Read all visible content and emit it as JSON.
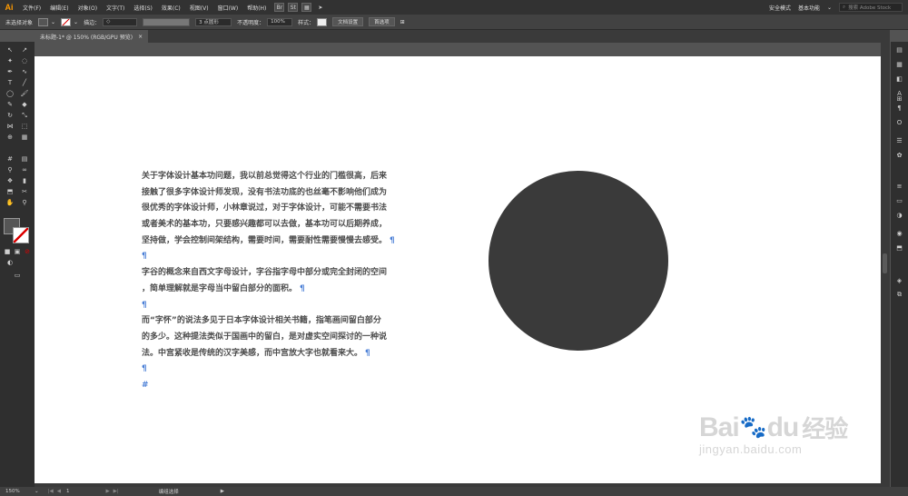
{
  "app": {
    "logo": "Ai"
  },
  "menu": {
    "items": [
      "文件(F)",
      "编辑(E)",
      "对象(O)",
      "文字(T)",
      "选择(S)",
      "效果(C)",
      "视图(V)",
      "窗口(W)",
      "帮助(H)"
    ],
    "app_icons": [
      "Br",
      "St"
    ],
    "workspace_mode": "安全模式",
    "workspace": "基本功能",
    "search_placeholder": "搜索 Adobe Stock"
  },
  "controlbar": {
    "selection": "未选择对象",
    "stroke_label": "描边：",
    "brush": "3 点圆形",
    "opacity_label": "不透明度：",
    "opacity_value": "100%",
    "style_label": "样式：",
    "doc_settings": "文档设置",
    "preferences": "首选项"
  },
  "tab": {
    "title": "未标题-1* @ 150% (RGB/GPU 预览)"
  },
  "status": {
    "zoom": "150%",
    "page": "1",
    "mode": "编组选择"
  },
  "document": {
    "lines": [
      "关于字体设计基本功问题，我以前总觉得这个行业的门槛很高，后来",
      "接触了很多字体设计师发现，没有书法功底的也丝毫不影响他们成为",
      "很优秀的字体设计师，小林章说过，对于字体设计，可能不需要书法",
      "或者美术的基本功，只要感兴趣都可以去做，基本功可以后期养成，",
      "坚持做，学会控制间架结构，需要时间，需要耐性需要慢慢去感受。",
      "",
      "字谷的概念来自西文字母设计，字谷指字母中部分或完全封闭的空间",
      "，简单理解就是字母当中留白部分的面积。",
      "",
      "而“字怀”的说法多见于日本字体设计相关书籍，指笔画间留白部分",
      "的多少。这种提法类似于国画中的留白，是对虚实空间探讨的一种说",
      "法。中宫紧收是传统的汉字美感，而中宫放大字也就看来大。",
      ""
    ],
    "pilcrow": "¶",
    "end_mark": "#"
  },
  "watermark": {
    "brand": "Bai",
    "brand2": "du",
    "cn": "经验",
    "url": "jingyan.baidu.com"
  },
  "colors": {
    "circle": "#3a3a3a",
    "pilcrow": "#4a7fd6",
    "accent": "#ff9a00"
  }
}
